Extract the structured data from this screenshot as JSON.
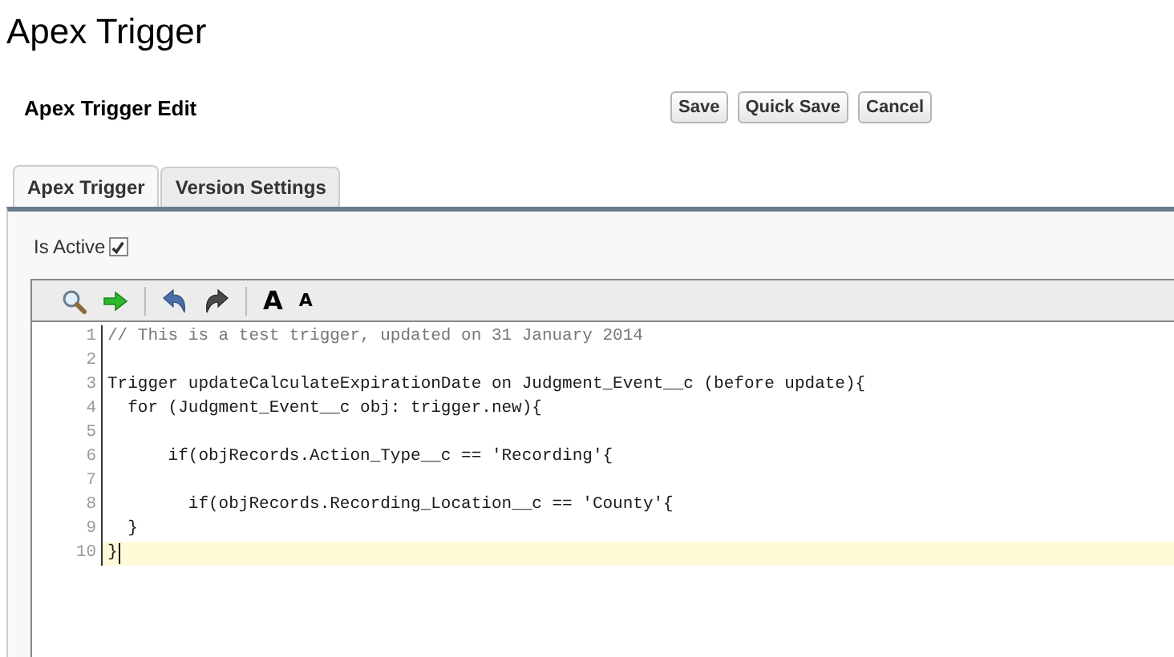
{
  "page_title": "Apex Trigger",
  "section": {
    "title": "Apex Trigger Edit",
    "buttons": [
      "Save",
      "Quick Save",
      "Cancel"
    ]
  },
  "tabs": [
    {
      "label": "Apex Trigger",
      "selected": true
    },
    {
      "label": "Version Settings",
      "selected": false
    }
  ],
  "is_active": {
    "label": "Is Active",
    "checked": true
  },
  "toolbar": [
    {
      "kind": "search"
    },
    {
      "kind": "go"
    },
    {
      "kind": "separator"
    },
    {
      "kind": "undo"
    },
    {
      "kind": "redo"
    },
    {
      "kind": "separator"
    },
    {
      "kind": "font-large",
      "label": "A"
    },
    {
      "kind": "font-small",
      "label": "A"
    }
  ],
  "code_lines": [
    {
      "number": "1",
      "kind": "comment",
      "text": "// This is a test trigger, updated on 31 January 2014",
      "current": false
    },
    {
      "number": "2",
      "current": false
    },
    {
      "number": "3",
      "kind": "code",
      "text": "Trigger updateCalculateExpirationDate on Judgment_Event__c (before update){",
      "current": false
    },
    {
      "number": "4",
      "kind": "code",
      "text": "  for (Judgment_Event__c obj: trigger.new){",
      "current": false
    },
    {
      "number": "5",
      "current": false
    },
    {
      "number": "6",
      "kind": "code",
      "text": "      if(objRecords.Action_Type__c == 'Recording'{",
      "current": false
    },
    {
      "number": "7",
      "current": false
    },
    {
      "number": "8",
      "kind": "code",
      "text": "        if(objRecords.Recording_Location__c == 'County'{",
      "current": false
    },
    {
      "number": "9",
      "kind": "code",
      "text": "  }",
      "current": false
    },
    {
      "number": "10",
      "kind": "code",
      "text": "}",
      "current": true
    }
  ]
}
